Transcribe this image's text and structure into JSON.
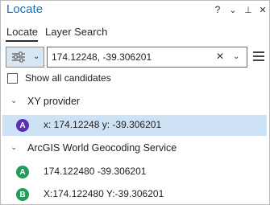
{
  "window": {
    "title": "Locate",
    "help": "?",
    "menu_glyph": "⌄",
    "pin_glyph": "⊥",
    "close_glyph": "✕"
  },
  "tabs": [
    {
      "label": "Locate",
      "active": true
    },
    {
      "label": "Layer Search",
      "active": false
    }
  ],
  "toolbar": {
    "provider_icon": "sliders-icon",
    "provider_caret": "⌄",
    "search_value": "174.12248, -39.306201",
    "clear_glyph": "✕",
    "dropdown_glyph": "⌄",
    "menu_icon": "hamburger-icon"
  },
  "options": {
    "show_all_label": "Show all candidates",
    "show_all_checked": false
  },
  "groups": [
    {
      "name": "XY provider",
      "chevron": "⌄",
      "results": [
        {
          "badge": "A",
          "text": "x: 174.12248 y: -39.306201",
          "color": "#5b2fb5",
          "selected": true
        }
      ]
    },
    {
      "name": "ArcGIS World Geocoding Service",
      "chevron": "⌄",
      "results": [
        {
          "badge": "A",
          "text": "174.122480 -39.306201",
          "color": "#1e9e57",
          "selected": false
        },
        {
          "badge": "B",
          "text": "X:174.122480 Y:-39.306201",
          "color": "#1e9e57",
          "selected": false
        }
      ]
    }
  ],
  "colors": {
    "title": "#1f6fba",
    "selected_row": "#cde3f5",
    "provider_button": "#d8e6f2"
  }
}
